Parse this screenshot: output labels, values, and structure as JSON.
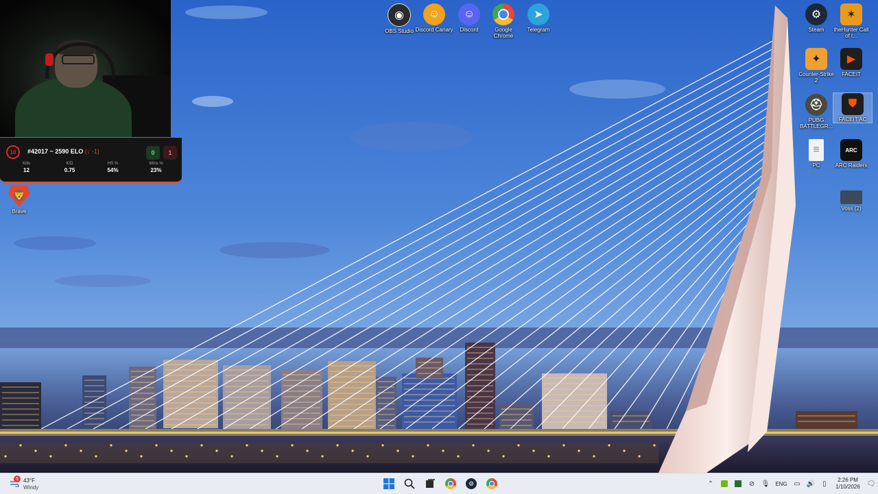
{
  "webcam": {
    "label": "webcam-feed"
  },
  "faceit_overlay": {
    "level": "10",
    "elo_text": "#42017 ~ 2590 ELO",
    "elo_delta": "(↓ -1)",
    "wins": "0",
    "losses": "1",
    "stats": [
      {
        "label": "Kills",
        "value": "12"
      },
      {
        "label": "K/D",
        "value": "0.75"
      },
      {
        "label": "HS %",
        "value": "54%"
      },
      {
        "label": "Wins %",
        "value": "23%"
      }
    ],
    "accent": "#e64a22"
  },
  "desktop_icons_left": [
    {
      "name": "Brave",
      "icon": "brave-icon",
      "color": "#e8462c"
    }
  ],
  "desktop_icons_top": [
    {
      "name": "OBS Studio",
      "icon": "obs-icon",
      "color": "#2b2b2b"
    },
    {
      "name": "Discord Canary",
      "icon": "discord-canary-icon",
      "color": "#f0a31c"
    },
    {
      "name": "Discord",
      "icon": "discord-icon",
      "color": "#5865f2"
    },
    {
      "name": "Google Chrome",
      "icon": "chrome-icon",
      "color": "#e8453c"
    },
    {
      "name": "Telegram",
      "icon": "telegram-icon",
      "color": "#2aa3de"
    }
  ],
  "desktop_icons_right": [
    {
      "name": "Steam",
      "icon": "steam-icon",
      "color": "#1b2838"
    },
    {
      "name": "theHunter Call of t...",
      "icon": "thehunter-icon",
      "color": "#e89a1c"
    },
    {
      "name": "Counter-Strike 2",
      "icon": "cs2-icon",
      "color": "#f0a030"
    },
    {
      "name": "FACEIT",
      "icon": "faceit-icon",
      "color": "#1e1e1e"
    },
    {
      "name": "PUBG BATTLEGR...",
      "icon": "pubg-icon",
      "color": "#4a4a3e"
    },
    {
      "name": "FACEIT AC",
      "icon": "faceit-ac-icon",
      "color": "#1e1e1e"
    },
    {
      "name": "PC",
      "icon": "file-icon",
      "color": "#f2f2f2"
    },
    {
      "name": "ARC Raiders",
      "icon": "arc-raiders-icon",
      "color": "#101010"
    },
    {
      "name": "Voss (2)",
      "icon": "monitor-icon",
      "color": "#3a4a5a"
    }
  ],
  "taskbar": {
    "weather": {
      "temp": "43°F",
      "condition": "Windy",
      "badge": "5"
    },
    "pinned": [
      {
        "name": "start",
        "icon": "windows-icon"
      },
      {
        "name": "search",
        "icon": "search-icon"
      },
      {
        "name": "file-explorer",
        "icon": "task-view-icon"
      },
      {
        "name": "chrome",
        "icon": "chrome-icon"
      },
      {
        "name": "steam",
        "icon": "steam-icon"
      },
      {
        "name": "chrome-profile",
        "icon": "chrome-icon"
      }
    ],
    "tray": {
      "language": "ENG",
      "time": "2:26 PM",
      "date": "1/10/2026"
    }
  }
}
